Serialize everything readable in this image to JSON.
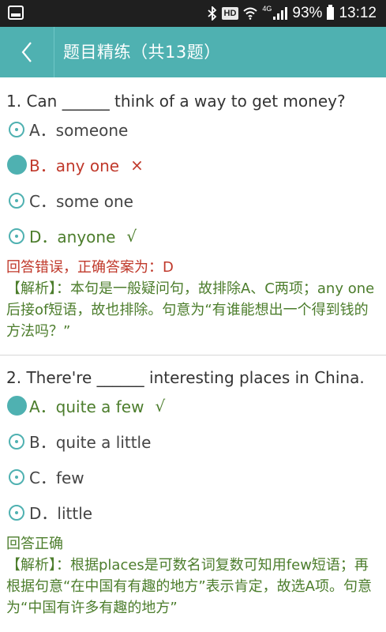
{
  "status_bar": {
    "hd": "HD",
    "network": "4G",
    "battery": "93%",
    "time": "13:12"
  },
  "header": {
    "title": "题目精练（共13题）"
  },
  "questions": [
    {
      "title": "1. Can ______ think of a way to get money?",
      "options": [
        {
          "text": "A．someone",
          "mark": ""
        },
        {
          "text": "B．any one",
          "mark": "×"
        },
        {
          "text": "C．some one",
          "mark": ""
        },
        {
          "text": "D．anyone",
          "mark": "√"
        }
      ],
      "result": "回答错误，正确答案为：D",
      "analysis": "【解析】：本句是一般疑问句，故排除A、C两项；any one后接of短语，故也排除。句意为“有谁能想出一个得到钱的方法吗？”"
    },
    {
      "title": "2. There're ______ interesting places in China.",
      "options": [
        {
          "text": "A．quite a few",
          "mark": "√"
        },
        {
          "text": "B．quite a little",
          "mark": ""
        },
        {
          "text": "C．few",
          "mark": ""
        },
        {
          "text": "D．little",
          "mark": ""
        }
      ],
      "result": "回答正确",
      "analysis": "【解析】：根据places是可数名词复数可知用few短语；再根据句意“在中国有有趣的地方”表示肯定，故选A项。句意为“中国有许多有趣的地方”"
    }
  ],
  "colors": {
    "accent": "#4fb1b1",
    "wrong": "#c0392b",
    "correct": "#4c7d2c"
  },
  "icons": {
    "back": "chevron-left-icon",
    "notification": "image-icon",
    "bluetooth": "bluetooth-icon",
    "wifi": "wifi-icon",
    "signal": "signal-icon",
    "battery": "battery-icon"
  }
}
